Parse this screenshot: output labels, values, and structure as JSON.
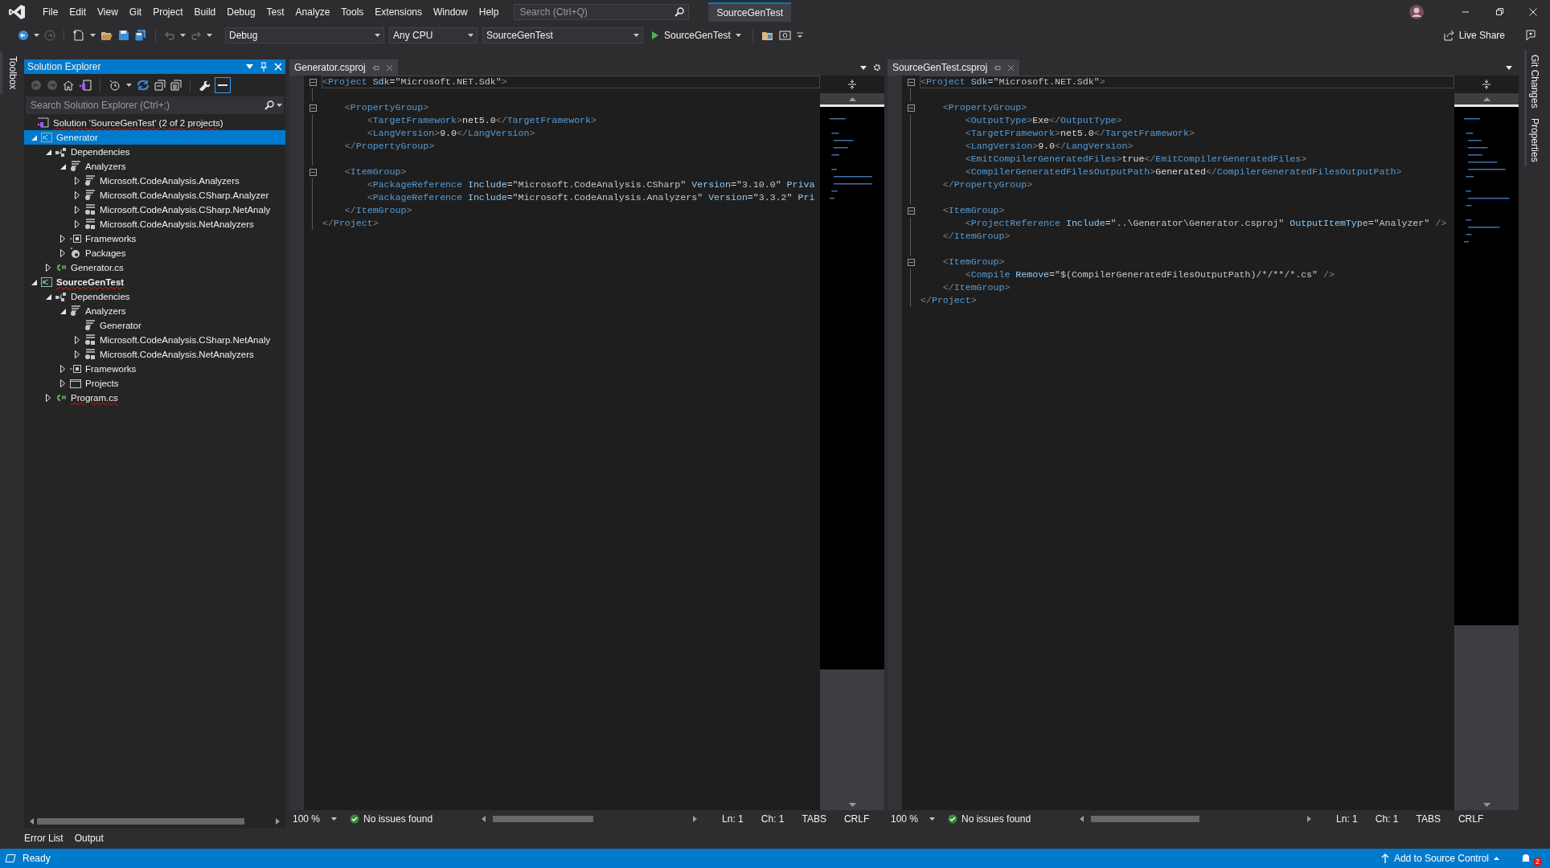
{
  "menu_bar": {
    "items": [
      "File",
      "Edit",
      "View",
      "Git",
      "Project",
      "Build",
      "Debug",
      "Test",
      "Analyze",
      "Tools",
      "Extensions",
      "Window",
      "Help"
    ],
    "search": {
      "placeholder": "Search (Ctrl+Q)"
    },
    "solution_name": "SourceGenTest"
  },
  "toolbar": {
    "configuration": "Debug",
    "platform": "Any CPU",
    "startup_project": "SourceGenTest",
    "run_button": "SourceGenTest",
    "live_share": "Live Share"
  },
  "left_strip": {
    "tabs": [
      "Toolbox"
    ]
  },
  "right_strip": {
    "tabs": [
      "Git Changes",
      "Properties"
    ]
  },
  "solution_explorer": {
    "title": "Solution Explorer",
    "search": {
      "placeholder": "Search Solution Explorer (Ctrl+;)"
    },
    "tree": [
      {
        "label": "Solution 'SourceGenTest' (2 of 2 projects)",
        "kind": "solution",
        "expandable": false,
        "selected": false,
        "bold": false,
        "squiggle": true,
        "children": [
          {
            "label": "Generator",
            "kind": "project",
            "expandable": true,
            "expanded": true,
            "selected": true,
            "bold": false,
            "squiggle": false,
            "children": [
              {
                "label": "Dependencies",
                "kind": "dependencies",
                "expandable": true,
                "expanded": true,
                "selected": false,
                "bold": false,
                "squiggle": false,
                "children": [
                  {
                    "label": "Analyzers",
                    "kind": "analyzers",
                    "expandable": true,
                    "expanded": true,
                    "selected": false,
                    "bold": false,
                    "squiggle": false,
                    "children": [
                      {
                        "label": "Microsoft.CodeAnalysis.Analyzers",
                        "kind": "analyzer",
                        "expandable": true,
                        "expanded": false,
                        "selected": false,
                        "bold": false,
                        "squiggle": false
                      },
                      {
                        "label": "Microsoft.CodeAnalysis.CSharp.Analyzer",
                        "kind": "analyzer",
                        "expandable": true,
                        "expanded": false,
                        "selected": false,
                        "bold": false,
                        "squiggle": false
                      },
                      {
                        "label": "Microsoft.CodeAnalysis.CSharp.NetAnaly",
                        "kind": "analyzer_package",
                        "expandable": true,
                        "expanded": false,
                        "selected": false,
                        "bold": false,
                        "squiggle": false
                      },
                      {
                        "label": "Microsoft.CodeAnalysis.NetAnalyzers",
                        "kind": "analyzer_package",
                        "expandable": true,
                        "expanded": false,
                        "selected": false,
                        "bold": false,
                        "squiggle": false
                      }
                    ]
                  },
                  {
                    "label": "Frameworks",
                    "kind": "frameworks",
                    "expandable": true,
                    "expanded": false,
                    "selected": false,
                    "bold": false,
                    "squiggle": false
                  },
                  {
                    "label": "Packages",
                    "kind": "packages",
                    "expandable": true,
                    "expanded": false,
                    "selected": false,
                    "bold": false,
                    "squiggle": false
                  }
                ]
              },
              {
                "label": "Generator.cs",
                "kind": "csharp_file",
                "expandable": true,
                "expanded": false,
                "selected": false,
                "bold": false,
                "squiggle": false
              }
            ]
          },
          {
            "label": "SourceGenTest",
            "kind": "project",
            "expandable": true,
            "expanded": true,
            "selected": false,
            "bold": true,
            "squiggle": true,
            "children": [
              {
                "label": "Dependencies",
                "kind": "dependencies",
                "expandable": true,
                "expanded": true,
                "selected": false,
                "bold": false,
                "squiggle": false,
                "children": [
                  {
                    "label": "Analyzers",
                    "kind": "analyzers",
                    "expandable": true,
                    "expanded": true,
                    "selected": false,
                    "bold": false,
                    "squiggle": false,
                    "children": [
                      {
                        "label": "Generator",
                        "kind": "analyzer",
                        "expandable": false,
                        "selected": false,
                        "bold": false,
                        "squiggle": false
                      },
                      {
                        "label": "Microsoft.CodeAnalysis.CSharp.NetAnaly",
                        "kind": "analyzer_package",
                        "expandable": true,
                        "expanded": false,
                        "selected": false,
                        "bold": false,
                        "squiggle": false
                      },
                      {
                        "label": "Microsoft.CodeAnalysis.NetAnalyzers",
                        "kind": "analyzer_package",
                        "expandable": true,
                        "expanded": false,
                        "selected": false,
                        "bold": false,
                        "squiggle": false
                      }
                    ]
                  },
                  {
                    "label": "Frameworks",
                    "kind": "frameworks",
                    "expandable": true,
                    "expanded": false,
                    "selected": false,
                    "bold": false,
                    "squiggle": false
                  },
                  {
                    "label": "Projects",
                    "kind": "projects",
                    "expandable": true,
                    "expanded": false,
                    "selected": false,
                    "bold": false,
                    "squiggle": false
                  }
                ]
              },
              {
                "label": "Program.cs",
                "kind": "csharp_file",
                "expandable": true,
                "expanded": false,
                "selected": false,
                "bold": false,
                "squiggle": true
              }
            ]
          }
        ]
      }
    ]
  },
  "editors": [
    {
      "tab": {
        "label": "Generator.csproj",
        "selected": true
      },
      "lines": [
        {
          "text": "<Project Sdk=\"Microsoft.NET.Sdk\">",
          "fold": true,
          "current": true
        },
        {
          "fold": false,
          "current": false
        },
        {
          "text": "    <PropertyGroup>",
          "fold": true,
          "current": false
        },
        {
          "text": "        <TargetFramework>net5.0</TargetFramework>",
          "fold": false,
          "current": false
        },
        {
          "text": "        <LangVersion>9.0</LangVersion>",
          "fold": false,
          "current": false
        },
        {
          "text": "    </PropertyGroup>",
          "fold": false,
          "current": false
        },
        {
          "fold": false,
          "current": false
        },
        {
          "text": "    <ItemGroup>",
          "fold": true,
          "current": false
        },
        {
          "text": "        <PackageReference Include=\"Microsoft.CodeAnalysis.CSharp\" Version=\"3.10.0\" Priva",
          "fold": false,
          "current": false
        },
        {
          "text": "        <PackageReference Include=\"Microsoft.CodeAnalysis.Analyzers\" Version=\"3.3.2\" Pri",
          "fold": false,
          "current": false
        },
        {
          "text": "    </ItemGroup>",
          "fold": false,
          "current": false
        },
        {
          "text": "</Project>",
          "fold": false,
          "current": false
        }
      ],
      "zoom": "100 %",
      "issues": "No issues found",
      "line": "Ln: 1",
      "column": "Ch: 1",
      "indent": "TABS",
      "line_ending": "CRLF"
    },
    {
      "tab": {
        "label": "SourceGenTest.csproj",
        "selected": true
      },
      "lines": [
        {
          "text": "<Project Sdk=\"Microsoft.NET.Sdk\">",
          "fold": true,
          "current": true
        },
        {
          "fold": false,
          "current": false
        },
        {
          "text": "    <PropertyGroup>",
          "fold": true,
          "current": false
        },
        {
          "text": "        <OutputType>Exe</OutputType>",
          "fold": false,
          "current": false
        },
        {
          "text": "        <TargetFramework>net5.0</TargetFramework>",
          "fold": false,
          "current": false
        },
        {
          "text": "        <LangVersion>9.0</LangVersion>",
          "fold": false,
          "current": false
        },
        {
          "text": "        <EmitCompilerGeneratedFiles>true</EmitCompilerGeneratedFiles>",
          "fold": false,
          "current": false
        },
        {
          "text": "        <CompilerGeneratedFilesOutputPath>Generated</CompilerGeneratedFilesOutputPath>",
          "fold": false,
          "current": false
        },
        {
          "text": "    </PropertyGroup>",
          "fold": false,
          "current": false
        },
        {
          "fold": false,
          "current": false
        },
        {
          "text": "    <ItemGroup>",
          "fold": true,
          "current": false
        },
        {
          "text": "        <ProjectReference Include=\"..\\Generator\\Generator.csproj\" OutputItemType=\"Analyzer\" />",
          "fold": false,
          "current": false
        },
        {
          "text": "    </ItemGroup>",
          "fold": false,
          "current": false
        },
        {
          "fold": false,
          "current": false
        },
        {
          "text": "    <ItemGroup>",
          "fold": true,
          "current": false
        },
        {
          "text": "        <Compile Remove=\"$(CompilerGeneratedFilesOutputPath)/*/**/*.cs\" />",
          "fold": false,
          "current": false
        },
        {
          "text": "    </ItemGroup>",
          "fold": false,
          "current": false
        },
        {
          "text": "</Project>",
          "fold": false,
          "current": false
        }
      ],
      "zoom": "100 %",
      "issues": "No issues found",
      "line": "Ln: 1",
      "column": "Ch: 1",
      "indent": "TABS",
      "line_ending": "CRLF"
    }
  ],
  "bottom_tabs": [
    {
      "label": "Error List",
      "selected": false
    },
    {
      "label": "Output",
      "selected": false
    }
  ],
  "status_bar": {
    "message": "Ready",
    "source_control": "Add to Source Control",
    "notifications": "2"
  }
}
